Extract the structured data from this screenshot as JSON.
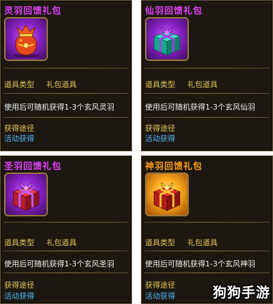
{
  "cards": [
    {
      "title": "灵羽回馈礼包",
      "type_label": "道具类型",
      "type_value": "礼包道具",
      "description": "使用后可随机获得1-3个玄风灵羽",
      "source_label": "获得途径",
      "source_value": "活动获得",
      "icon": "lucky-bag-icon",
      "title_color": "#e640ff"
    },
    {
      "title": "仙羽回馈礼包",
      "type_label": "道具类型",
      "type_value": "礼包道具",
      "description": "使用后可随机获得1-3个玄风仙羽",
      "source_label": "获得途径",
      "source_value": "活动获得",
      "icon": "teal-gift-box-icon",
      "title_color": "#e640ff"
    },
    {
      "title": "圣羽回馈礼包",
      "type_label": "道具类型",
      "type_value": "礼包道具",
      "description": "使用后可随机获得1-3个玄风圣羽",
      "source_label": "获得途径",
      "source_value": "活动获得",
      "icon": "red-gift-box-icon",
      "title_color": "#e640ff"
    },
    {
      "title": "神羽回馈礼包",
      "type_label": "道具类型",
      "type_value": "礼包道具",
      "description": "使用后可随机获得1-3个玄风神羽",
      "source_label": "获得途径",
      "source_value": "活动获得",
      "icon": "golden-gift-box-icon",
      "title_color": "#ff9c1a"
    }
  ],
  "watermark": "狗狗手游"
}
